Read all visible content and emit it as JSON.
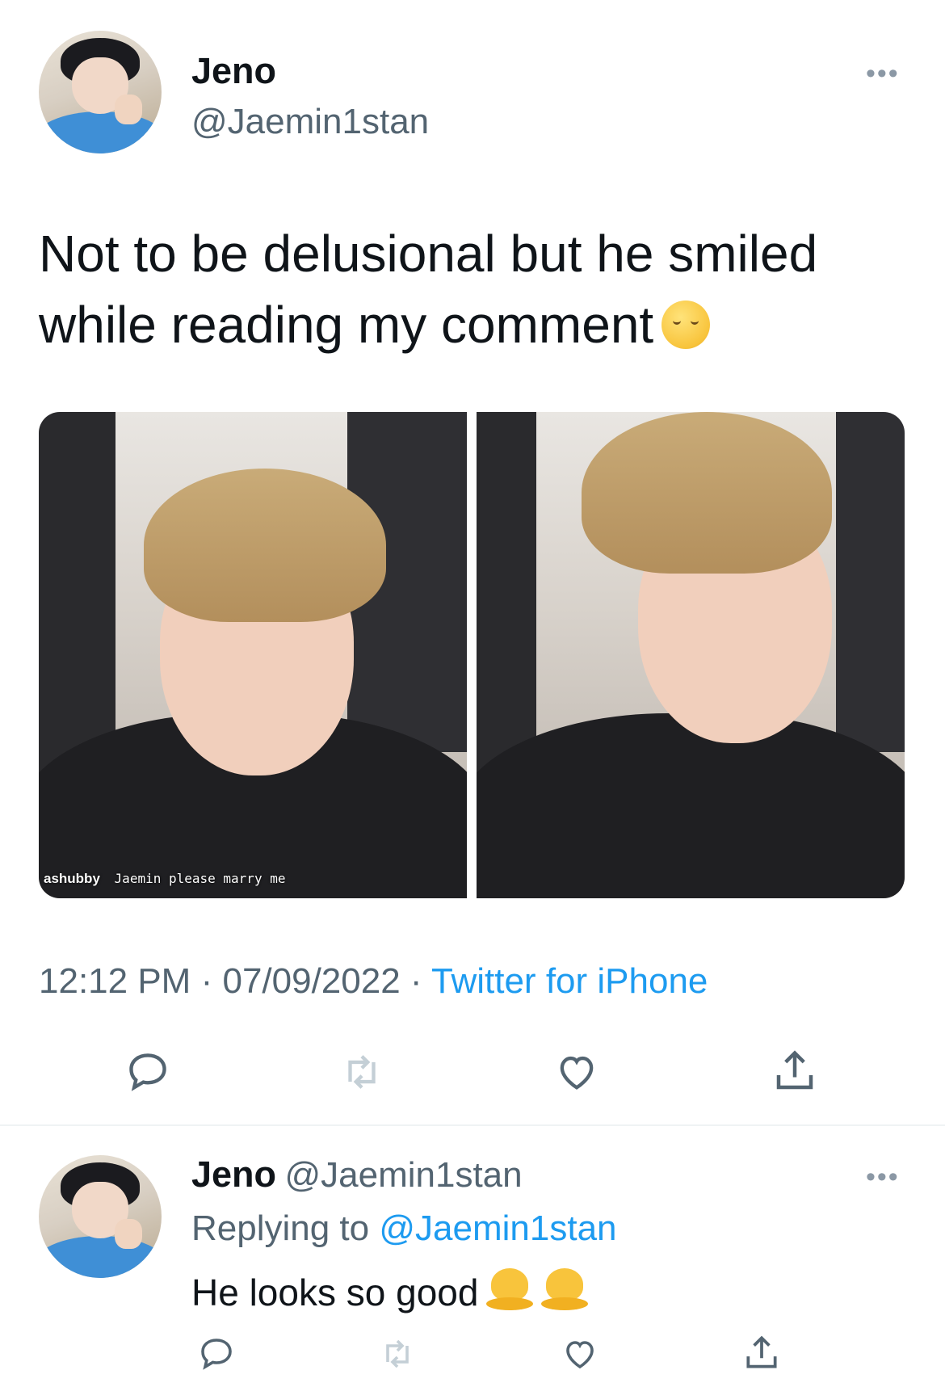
{
  "tweet": {
    "author_name": "Jeno",
    "author_handle": "@Jaemin1stan",
    "more_label": "•••",
    "text": "Not to be delusional but he smiled while reading my comment",
    "text_emoji": "relieved-face",
    "media_caption_user": "ashubby",
    "media_caption_text": "Jaemin please marry me",
    "time": "12:12 PM",
    "date": "07/09/2022",
    "separator": "·",
    "source": "Twitter for iPhone",
    "accent_color": "#1d9bf0",
    "actions": [
      "reply-icon",
      "retweet-icon",
      "like-icon",
      "share-icon"
    ]
  },
  "reply": {
    "author_name": "Jeno",
    "author_handle": "@Jaemin1stan",
    "more_label": "•••",
    "replying_prefix": "Replying to",
    "replying_to": "@Jaemin1stan",
    "text": "He looks so good",
    "text_emojis": [
      "melting-face",
      "melting-face"
    ],
    "actions": [
      "reply-icon",
      "retweet-icon",
      "like-icon",
      "share-icon"
    ]
  }
}
